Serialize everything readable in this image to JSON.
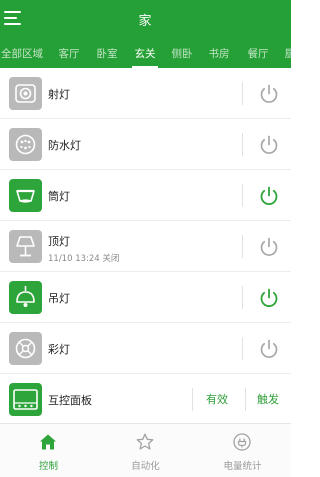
{
  "header": {
    "title": "家"
  },
  "tabs": [
    {
      "label": "全部区域"
    },
    {
      "label": "客厅"
    },
    {
      "label": "卧室"
    },
    {
      "label": "玄关",
      "active": true
    },
    {
      "label": "侧卧"
    },
    {
      "label": "书房"
    },
    {
      "label": "餐厅"
    },
    {
      "label": "厨"
    }
  ],
  "devices": [
    {
      "name": "射灯",
      "icon": "spotlight-icon",
      "state": "off"
    },
    {
      "name": "防水灯",
      "icon": "waterproof-light-icon",
      "state": "off"
    },
    {
      "name": "筒灯",
      "icon": "downlight-icon",
      "state": "on"
    },
    {
      "name": "顶灯",
      "icon": "table-lamp-icon",
      "state": "off",
      "status": "11/10 13:24 关闭"
    },
    {
      "name": "吊灯",
      "icon": "pendant-lamp-icon",
      "state": "on"
    },
    {
      "name": "彩灯",
      "icon": "colored-light-icon",
      "state": "off"
    }
  ],
  "panel": {
    "name": "互控面板",
    "icon": "control-panel-icon",
    "valid_label": "有效",
    "trigger_label": "触发"
  },
  "bottom_nav": [
    {
      "label": "控制",
      "icon": "home-icon",
      "active": true
    },
    {
      "label": "自动化",
      "icon": "star-icon"
    },
    {
      "label": "电量统计",
      "icon": "plug-icon"
    }
  ],
  "colors": {
    "brand_green": "#25a036",
    "on_green": "#2ea53a",
    "off_gray": "#b9b9b9",
    "power_off": "#a8a8a8"
  }
}
